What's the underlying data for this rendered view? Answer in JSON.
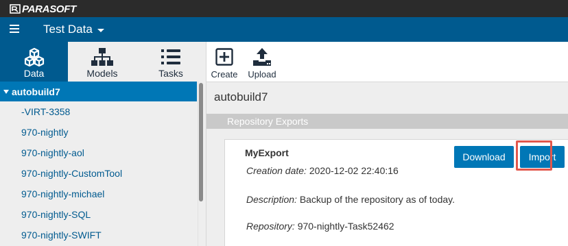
{
  "brand": {
    "name": "PARASOFT",
    "color": "#ffffff"
  },
  "appbar": {
    "menu_icon": "hamburger-icon",
    "title": "Test Data",
    "title_dropdown_icon": "caret-down-icon",
    "color": "#005a8f"
  },
  "nav": {
    "tabs": [
      {
        "label": "Data",
        "icon": "cubes-icon",
        "active": true
      },
      {
        "label": "Models",
        "icon": "hierarchy-icon",
        "active": false
      },
      {
        "label": "Tasks",
        "icon": "list-icon",
        "active": false
      }
    ]
  },
  "toolbar": {
    "create_label": "Create",
    "create_icon": "plus-square-icon",
    "upload_label": "Upload",
    "upload_icon": "upload-icon"
  },
  "sidebar": {
    "root": {
      "label": "autobuild7",
      "expanded": true
    },
    "items": [
      "-VIRT-3358",
      "970-nightly",
      "970-nightly-aol",
      "970-nightly-CustomTool",
      "970-nightly-michael",
      "970-nightly-SQL",
      "970-nightly-SWIFT"
    ]
  },
  "main": {
    "title": "autobuild7",
    "section_title": "Repository Exports",
    "export": {
      "name": "MyExport",
      "creation_label": "Creation date:",
      "creation_value": "2020-12-02 22:40:16",
      "description_label": "Description:",
      "description_value": "Backup of the repository as of today.",
      "repository_label": "Repository:",
      "repository_value": "970-nightly-Task52462",
      "download_label": "Download",
      "import_label": "Import"
    }
  },
  "colors": {
    "accent": "#0077b6",
    "highlight": "#e2574c",
    "sidebar_bg": "#eeeeee"
  }
}
